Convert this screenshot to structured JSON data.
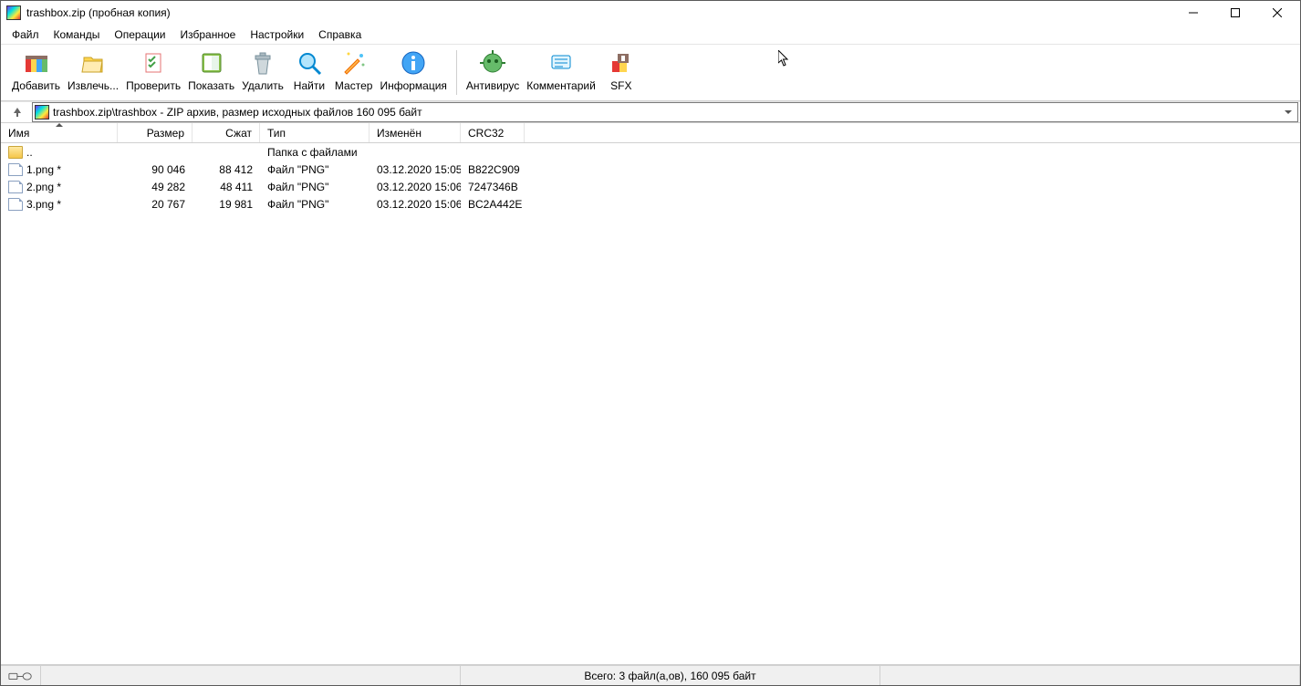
{
  "title": "trashbox.zip (пробная копия)",
  "menu": [
    "Файл",
    "Команды",
    "Операции",
    "Избранное",
    "Настройки",
    "Справка"
  ],
  "toolbar": [
    {
      "id": "add",
      "label": "Добавить",
      "icon": "add"
    },
    {
      "id": "extract",
      "label": "Извлечь...",
      "icon": "extract"
    },
    {
      "id": "test",
      "label": "Проверить",
      "icon": "test"
    },
    {
      "id": "view",
      "label": "Показать",
      "icon": "view"
    },
    {
      "id": "delete",
      "label": "Удалить",
      "icon": "delete"
    },
    {
      "id": "find",
      "label": "Найти",
      "icon": "find"
    },
    {
      "id": "wizard",
      "label": "Мастер",
      "icon": "wizard"
    },
    {
      "id": "info",
      "label": "Информация",
      "icon": "info"
    },
    {
      "sep": true
    },
    {
      "id": "antivirus",
      "label": "Антивирус",
      "icon": "antivirus"
    },
    {
      "id": "comment",
      "label": "Комментарий",
      "icon": "comment"
    },
    {
      "id": "sfx",
      "label": "SFX",
      "icon": "sfx"
    }
  ],
  "path": "trashbox.zip\\trashbox - ZIP архив, размер исходных файлов 160 095 байт",
  "columns": {
    "name": "Имя",
    "size": "Размер",
    "packed": "Сжат",
    "type": "Тип",
    "modified": "Изменён",
    "crc": "CRC32"
  },
  "parent_row": {
    "name": "..",
    "type": "Папка с файлами"
  },
  "rows": [
    {
      "name": "1.png *",
      "size": "90 046",
      "packed": "88 412",
      "type": "Файл \"PNG\"",
      "modified": "03.12.2020 15:05",
      "crc": "B822C909"
    },
    {
      "name": "2.png *",
      "size": "49 282",
      "packed": "48 411",
      "type": "Файл \"PNG\"",
      "modified": "03.12.2020 15:06",
      "crc": "7247346B"
    },
    {
      "name": "3.png *",
      "size": "20 767",
      "packed": "19 981",
      "type": "Файл \"PNG\"",
      "modified": "03.12.2020 15:06",
      "crc": "BC2A442E"
    }
  ],
  "status": {
    "left": "",
    "mid": "Всего: 3 файл(а,ов), 160 095 байт",
    "right": ""
  }
}
